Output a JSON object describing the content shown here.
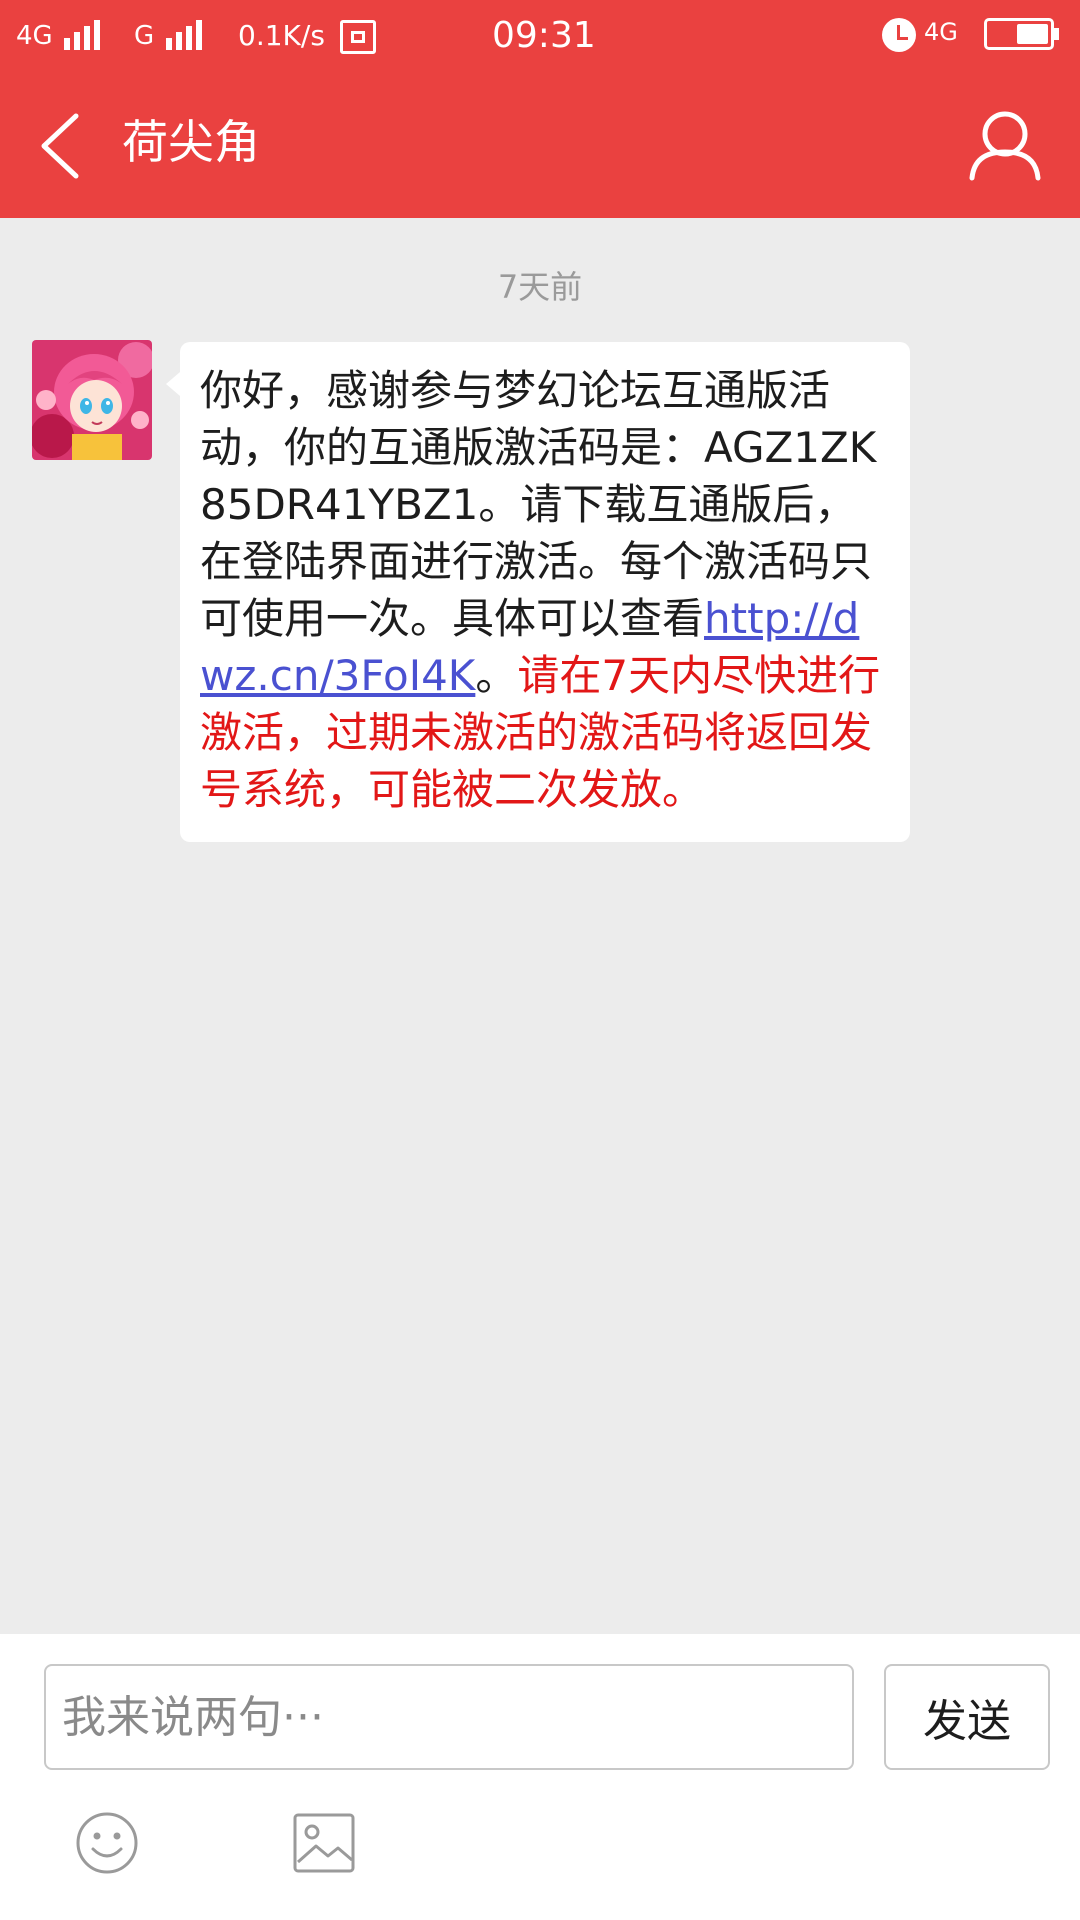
{
  "status_bar": {
    "network1": "4G",
    "network2": "G",
    "speed": "0.1K/s",
    "time": "09:31",
    "network3": "4G",
    "icons": [
      "signal-icon",
      "tray-icon",
      "alarm-icon",
      "battery-icon"
    ]
  },
  "header": {
    "title": "荷尖角",
    "back_icon": "chevron-left-icon",
    "profile_icon": "person-icon",
    "color": "#ea4140"
  },
  "chat": {
    "timestamp": "7天前",
    "message": {
      "part1": "你好，感谢参与梦幻论坛互通版活动，你的互通版激活码是：AGZ1ZK85DR41YBZ1。请下载互通版后，在登陆界面进行激活。每个激活码只可使用一次。具体可以查看",
      "link": "http://dwz.cn/3FoI4K",
      "part2": "。",
      "warning": "请在7天内尽快进行激活，过期未激活的激活码将返回发号系统，可能被二次发放。"
    },
    "link_color": "#4a51d1",
    "warning_color": "#e21717"
  },
  "composer": {
    "placeholder": "我来说两句···",
    "value": "",
    "send_label": "发送",
    "emoji_icon": "smiley-icon",
    "image_icon": "image-icon"
  }
}
